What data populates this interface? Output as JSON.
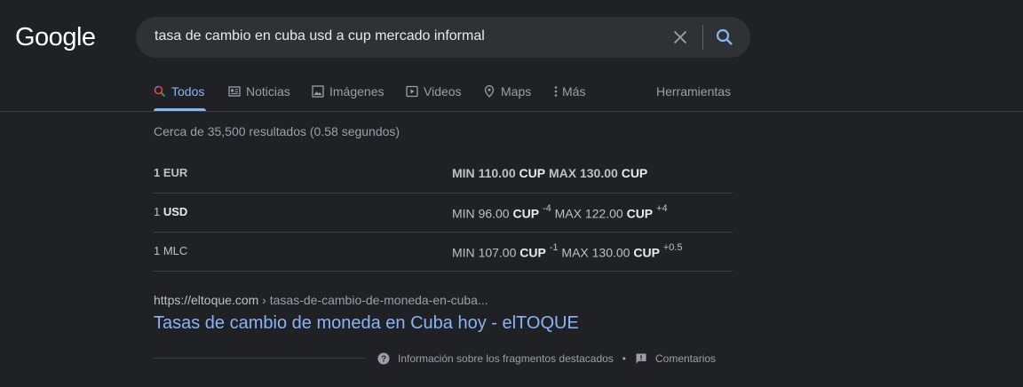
{
  "logo": "Google",
  "search": {
    "query": "tasa de cambio en cuba usd a cup mercado informal"
  },
  "tabs": [
    {
      "label": "Todos",
      "icon": "search-icon",
      "active": true
    },
    {
      "label": "Noticias",
      "icon": "news-icon"
    },
    {
      "label": "Imágenes",
      "icon": "image-icon"
    },
    {
      "label": "Videos",
      "icon": "video-icon"
    },
    {
      "label": "Maps",
      "icon": "map-pin-icon"
    },
    {
      "label": "Más",
      "icon": "more-vert-icon"
    }
  ],
  "tools_label": "Herramientas",
  "stats": "Cerca de 35,500 resultados (0.58 segundos)",
  "rates": [
    {
      "currency": "1 EUR",
      "min_label": "MIN",
      "min": "110.00",
      "min_unit": "CUP",
      "min_change": "",
      "max_label": "MAX",
      "max": "130.00",
      "max_unit": "CUP",
      "max_change": ""
    },
    {
      "currency_prefix": "1",
      "currency_code": "USD",
      "min_label": "MIN",
      "min": "96.00",
      "min_unit": "CUP",
      "min_change": "-4",
      "max_label": "MAX",
      "max": "122.00",
      "max_unit": "CUP",
      "max_change": "+4"
    },
    {
      "currency": "1 MLC",
      "min_label": "MIN",
      "min": "107.00",
      "min_unit": "CUP",
      "min_change": "-1",
      "max_label": "MAX",
      "max": "130.00",
      "max_unit": "CUP",
      "max_change": "+0.5"
    }
  ],
  "result": {
    "site": "https://eltoque.com",
    "path": " › tasas-de-cambio-de-moneda-en-cuba...",
    "title": "Tasas de cambio de moneda en Cuba hoy - elTOQUE"
  },
  "footer": {
    "info_label": "Información sobre los fragmentos destacados",
    "separator": "•",
    "feedback_label": "Comentarios"
  },
  "colors": {
    "background": "#202124",
    "link": "#8ab4f8",
    "text": "#bdc1c6"
  }
}
